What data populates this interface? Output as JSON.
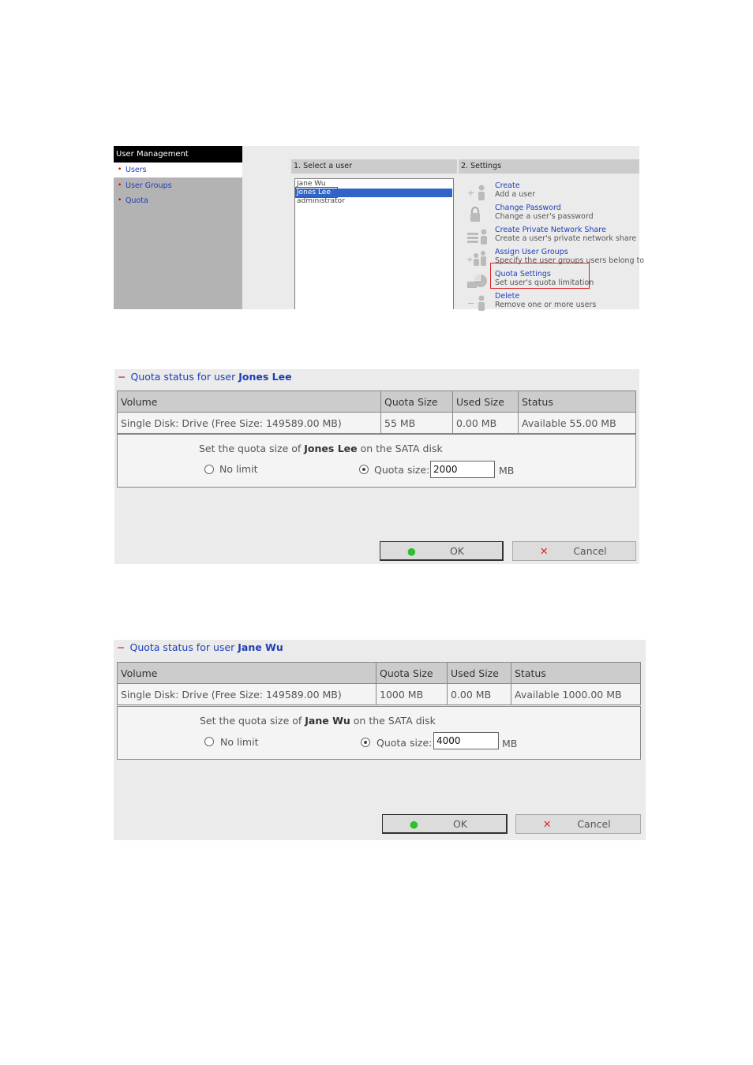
{
  "user_management": {
    "title": "User Management",
    "nav": [
      "Users",
      "User Groups",
      "Quota"
    ],
    "select_user_header": "1. Select a user",
    "settings_header": "2. Settings",
    "users": [
      "Jane Wu",
      "Jones Lee",
      "administrator"
    ],
    "selected_user": "Jones Lee",
    "settings": [
      {
        "title": "Create",
        "desc": "Add a user",
        "icon": "user-add-icon"
      },
      {
        "title": "Change Password",
        "desc": "Change a user's password",
        "icon": "lock-icon"
      },
      {
        "title": "Create Private Network Share",
        "desc": "Create a user's private network share",
        "icon": "network-share-icon"
      },
      {
        "title": "Assign User Groups",
        "desc": "Specify the user groups users belong to",
        "icon": "user-groups-icon"
      },
      {
        "title": "Quota Settings",
        "desc": "Set user's quota limitation",
        "icon": "quota-pie-icon"
      },
      {
        "title": "Delete",
        "desc": "Remove one or more users",
        "icon": "user-remove-icon"
      }
    ],
    "highlight_color": "#e02020",
    "selection_color": "#3164c8"
  },
  "quota_panels": [
    {
      "title_prefix": "Quota status for user",
      "user": "Jones Lee",
      "columns": [
        "Volume",
        "Quota Size",
        "Used Size",
        "Status"
      ],
      "row": [
        "Single Disk: Drive (Free Size: 149589.00 MB)",
        "55 MB",
        "0.00 MB",
        "Available 55.00 MB"
      ],
      "set_text_before": "Set the quota size of",
      "set_text_after": "on the SATA disk",
      "no_limit_label": "No limit",
      "quota_size_label": "Quota size:",
      "quota_value": "2000",
      "unit": "MB",
      "ok_label": "OK",
      "cancel_label": "Cancel"
    },
    {
      "title_prefix": "Quota status for user",
      "user": "Jane Wu",
      "columns": [
        "Volume",
        "Quota Size",
        "Used Size",
        "Status"
      ],
      "row": [
        "Single Disk: Drive (Free Size: 149589.00 MB)",
        "1000 MB",
        "0.00 MB",
        "Available 1000.00 MB"
      ],
      "set_text_before": "Set the quota size of",
      "set_text_after": "on the SATA disk",
      "no_limit_label": "No limit",
      "quota_size_label": "Quota size:",
      "quota_value": "4000",
      "unit": "MB",
      "ok_label": "OK",
      "cancel_label": "Cancel"
    }
  ]
}
